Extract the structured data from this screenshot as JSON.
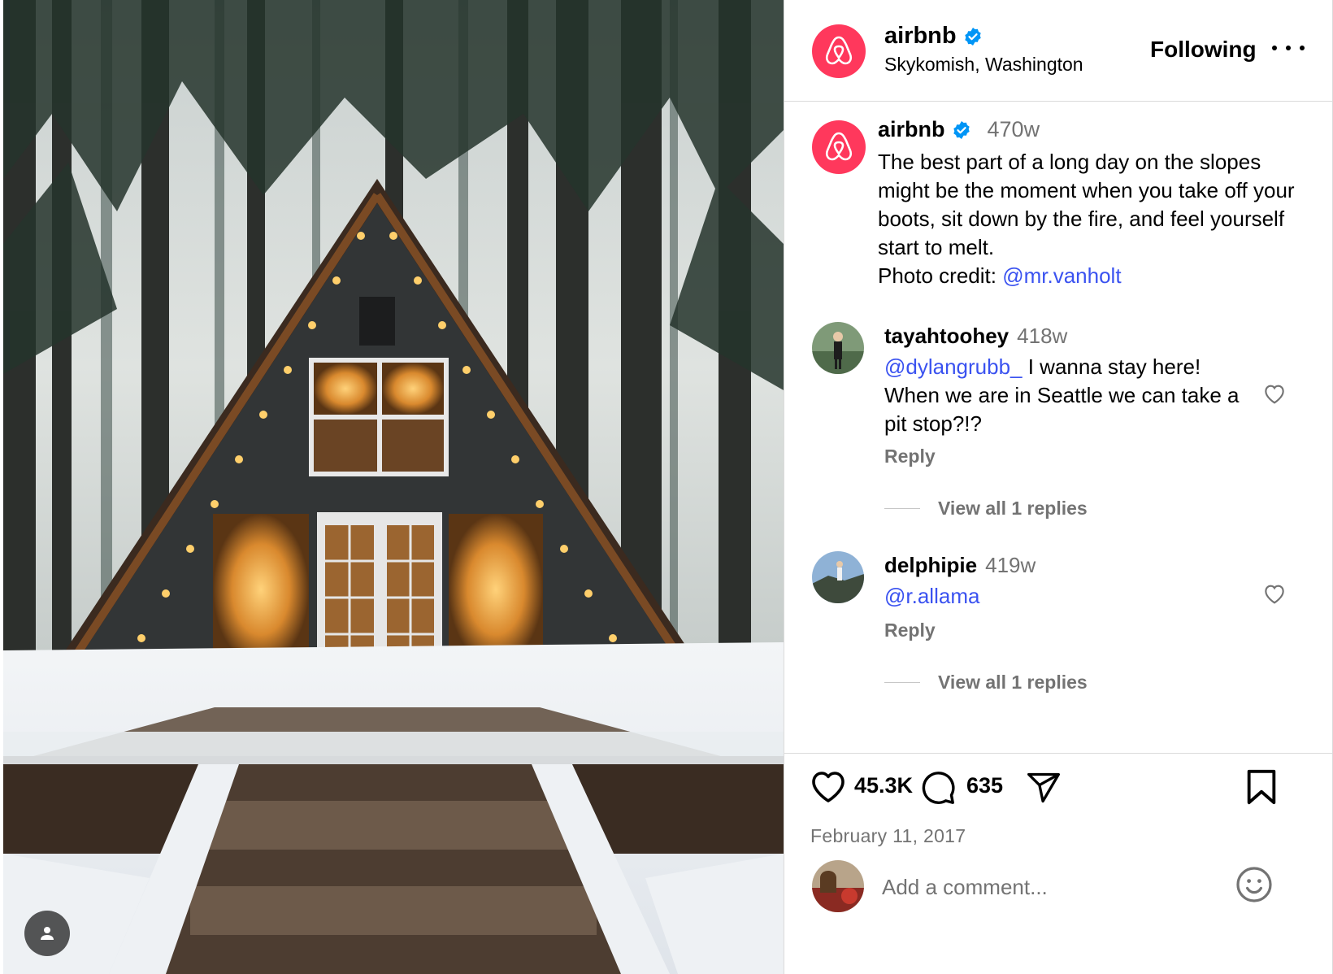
{
  "header": {
    "username": "airbnb",
    "location": "Skykomish, Washington",
    "follow_label": "Following"
  },
  "caption": {
    "username": "airbnb",
    "time": "470w",
    "text": "The best part of a long day on the slopes might be the moment when you take off your boots, sit down by the fire, and feel yourself start to melt.",
    "credit_prefix": "Photo credit: ",
    "credit_handle": "@mr.vanholt"
  },
  "comments": [
    {
      "username": "tayahtoohey",
      "time": "418w",
      "mention": "@dylangrubb_",
      "text": " I wanna stay here! When we are in Seattle we can take a pit stop?!?",
      "reply_label": "Reply",
      "view_replies": "View all 1 replies"
    },
    {
      "username": "delphipie",
      "time": "419w",
      "mention": "@r.allama",
      "text": "",
      "reply_label": "Reply",
      "view_replies": "View all 1 replies"
    }
  ],
  "stats": {
    "likes": "45.3K",
    "comments": "635",
    "date": "February 11, 2017"
  },
  "add_comment": {
    "placeholder": "Add a comment..."
  },
  "icons": {
    "brand_logo": "airbnb-logo-icon",
    "verified": "verified-badge-icon",
    "more": "more-options-icon",
    "like": "heart-icon",
    "comment": "comment-bubble-icon",
    "share": "paper-plane-icon",
    "save": "bookmark-icon",
    "emoji": "emoji-icon",
    "tag": "user-tag-icon"
  },
  "colors": {
    "brand": "#ff385c",
    "verified": "#0095f6",
    "link": "#3a52f0",
    "muted": "#737373"
  }
}
